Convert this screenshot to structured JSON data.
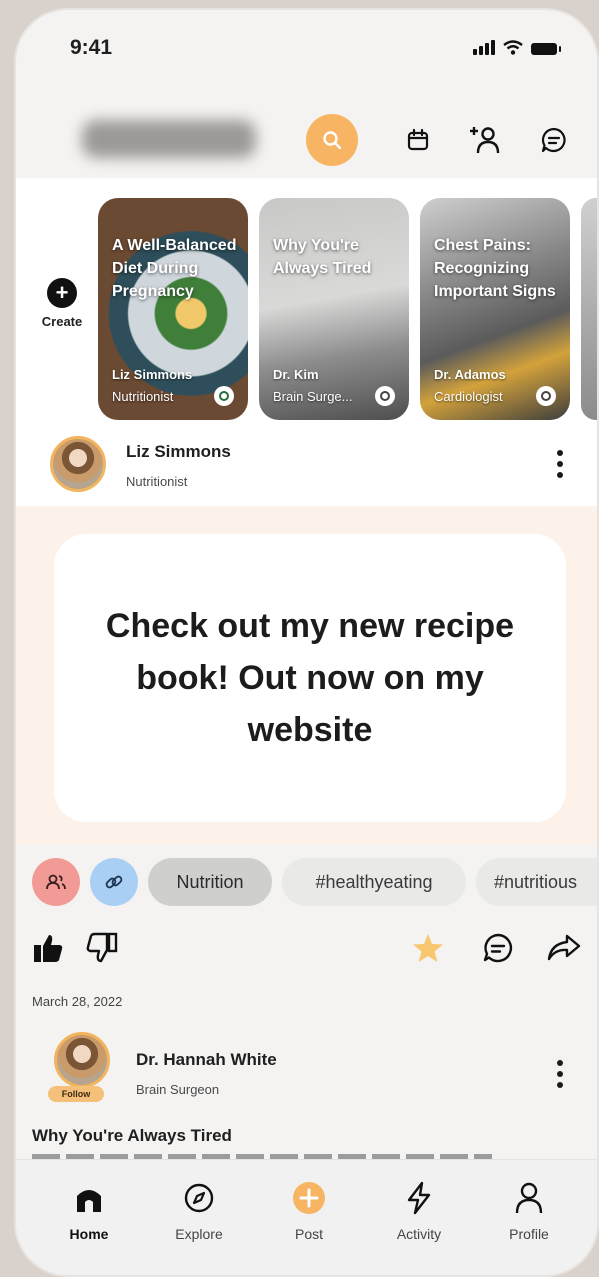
{
  "status_bar": {
    "time": "9:41"
  },
  "header": {
    "icons": [
      "search-icon",
      "calendar-icon",
      "add-person-icon",
      "chat-icon"
    ],
    "accent": "#f7b463"
  },
  "stories": {
    "create_label": "Create",
    "items": [
      {
        "title": "A Well-Balanced Diet During Pregnancy",
        "author": "Liz Simmons",
        "role": "Nutritionist"
      },
      {
        "title": "Why You're Always Tired",
        "author": "Dr. Kim",
        "role": "Brain Surge..."
      },
      {
        "title": "Chest Pains: Recognizing Important Signs",
        "author": "Dr. Adamos",
        "role": "Cardiologist"
      }
    ]
  },
  "post": {
    "author": "Liz Simmons",
    "role": "Nutritionist",
    "text": "Check out my new recipe book! Out now on my website",
    "background": "#fdf2ea",
    "tags": [
      "Nutrition",
      "#healthyeating",
      "#nutritious"
    ],
    "date": "March 28, 2022"
  },
  "next_post": {
    "author": "Dr. Hannah White",
    "role": "Brain Surgeon",
    "follow_label": "Follow",
    "title": "Why You're Always Tired"
  },
  "tabbar": {
    "items": [
      {
        "label": "Home",
        "icon": "home-icon",
        "active": true
      },
      {
        "label": "Explore",
        "icon": "compass-icon"
      },
      {
        "label": "Post",
        "icon": "plus-circle-icon"
      },
      {
        "label": "Activity",
        "icon": "lightning-icon"
      },
      {
        "label": "Profile",
        "icon": "profile-icon"
      }
    ]
  }
}
